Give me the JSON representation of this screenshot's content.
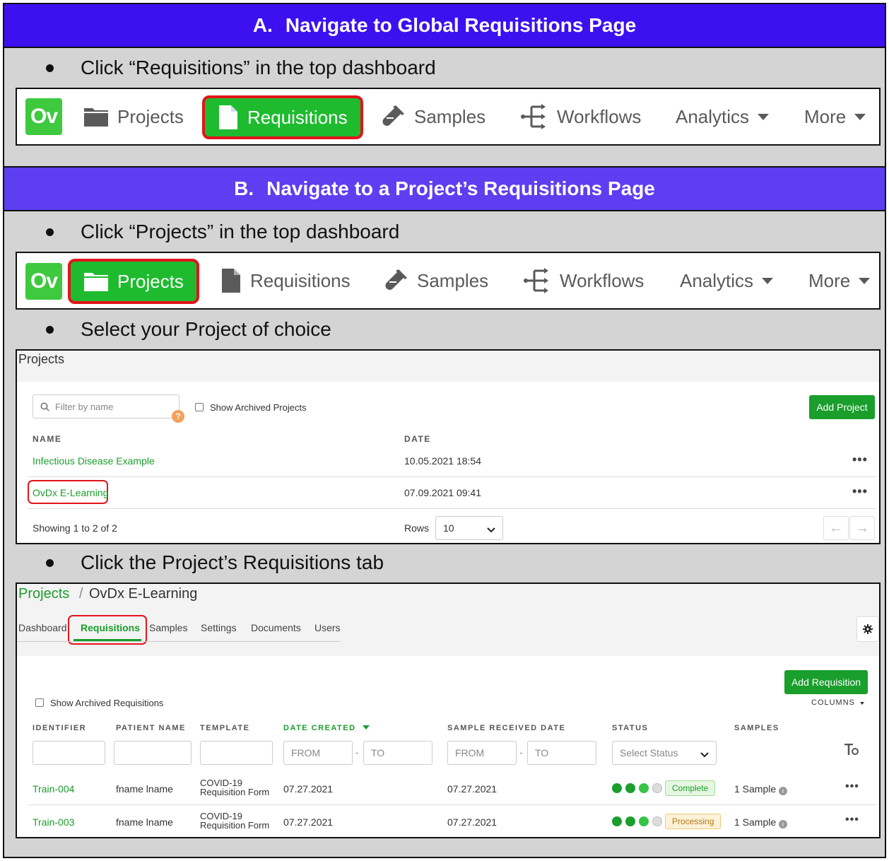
{
  "section_a": {
    "letter": "A.",
    "title": "Navigate to Global Requisitions Page",
    "bullet": "Click “Requisitions” in the top dashboard",
    "nav": {
      "logo": "Ov",
      "projects": "Projects",
      "requisitions": "Requisitions",
      "samples": "Samples",
      "workflows": "Workflows",
      "analytics": "Analytics",
      "more": "More",
      "active": "requisitions"
    }
  },
  "section_b": {
    "letter": "B.",
    "title": "Navigate to a Project’s Requisitions Page",
    "bullet1": "Click “Projects” in the top dashboard",
    "nav": {
      "logo": "Ov",
      "projects": "Projects",
      "requisitions": "Requisitions",
      "samples": "Samples",
      "workflows": "Workflows",
      "analytics": "Analytics",
      "more": "More",
      "active": "projects"
    },
    "bullet2": "Select your Project of choice",
    "bullet3": "Click the Project’s Requisitions tab"
  },
  "projects_page": {
    "title": "Projects",
    "filter_placeholder": "Filter by name",
    "help": "?",
    "show_archived": "Show Archived Projects",
    "add_button": "Add Project",
    "columns": [
      "NAME",
      "DATE"
    ],
    "rows": [
      {
        "name": "Infectious Disease Example",
        "date": "10.05.2021 18:54"
      },
      {
        "name": "OvDx E-Learning",
        "date": "07.09.2021 09:41"
      }
    ],
    "more_glyph": "•••",
    "showing": "Showing 1 to 2 of 2",
    "rows_label": "Rows",
    "rows_value": "10",
    "prev_glyph": "←",
    "next_glyph": "→"
  },
  "project_detail": {
    "breadcrumb_root": "Projects",
    "breadcrumb_sep": "/",
    "breadcrumb_current": "OvDx E-Learning",
    "tabs": [
      "Dashboard",
      "Requisitions",
      "Samples",
      "Settings",
      "Documents",
      "Users"
    ],
    "active_tab": "Requisitions",
    "add_button": "Add Requisition",
    "show_archived": "Show Archived Requisitions",
    "columns_label": "COLUMNS",
    "headers": [
      "IDENTIFIER",
      "PATIENT NAME",
      "TEMPLATE",
      "DATE CREATED",
      "SAMPLE RECEIVED DATE",
      "STATUS",
      "SAMPLES"
    ],
    "from": "FROM",
    "to": "TO",
    "dash": "-",
    "select_status": "Select Status",
    "rows": [
      {
        "id": "Train-004",
        "patient": "fname lname",
        "template_1": "COVID-19",
        "template_2": "Requisition Form",
        "created": "07.27.2021",
        "received": "07.27.2021",
        "status": "Complete",
        "samples": "1 Sample"
      },
      {
        "id": "Train-003",
        "patient": "fname lname",
        "template_1": "COVID-19",
        "template_2": "Requisition Form",
        "created": "07.27.2021",
        "received": "07.27.2021",
        "status": "Processing",
        "samples": "1 Sample"
      }
    ],
    "more_glyph": "•••"
  },
  "colors": {
    "header_a": "#3d10f0",
    "header_b": "#5d3ef0",
    "accent_green": "#1a9e2c",
    "highlight_red": "#e3141b"
  }
}
